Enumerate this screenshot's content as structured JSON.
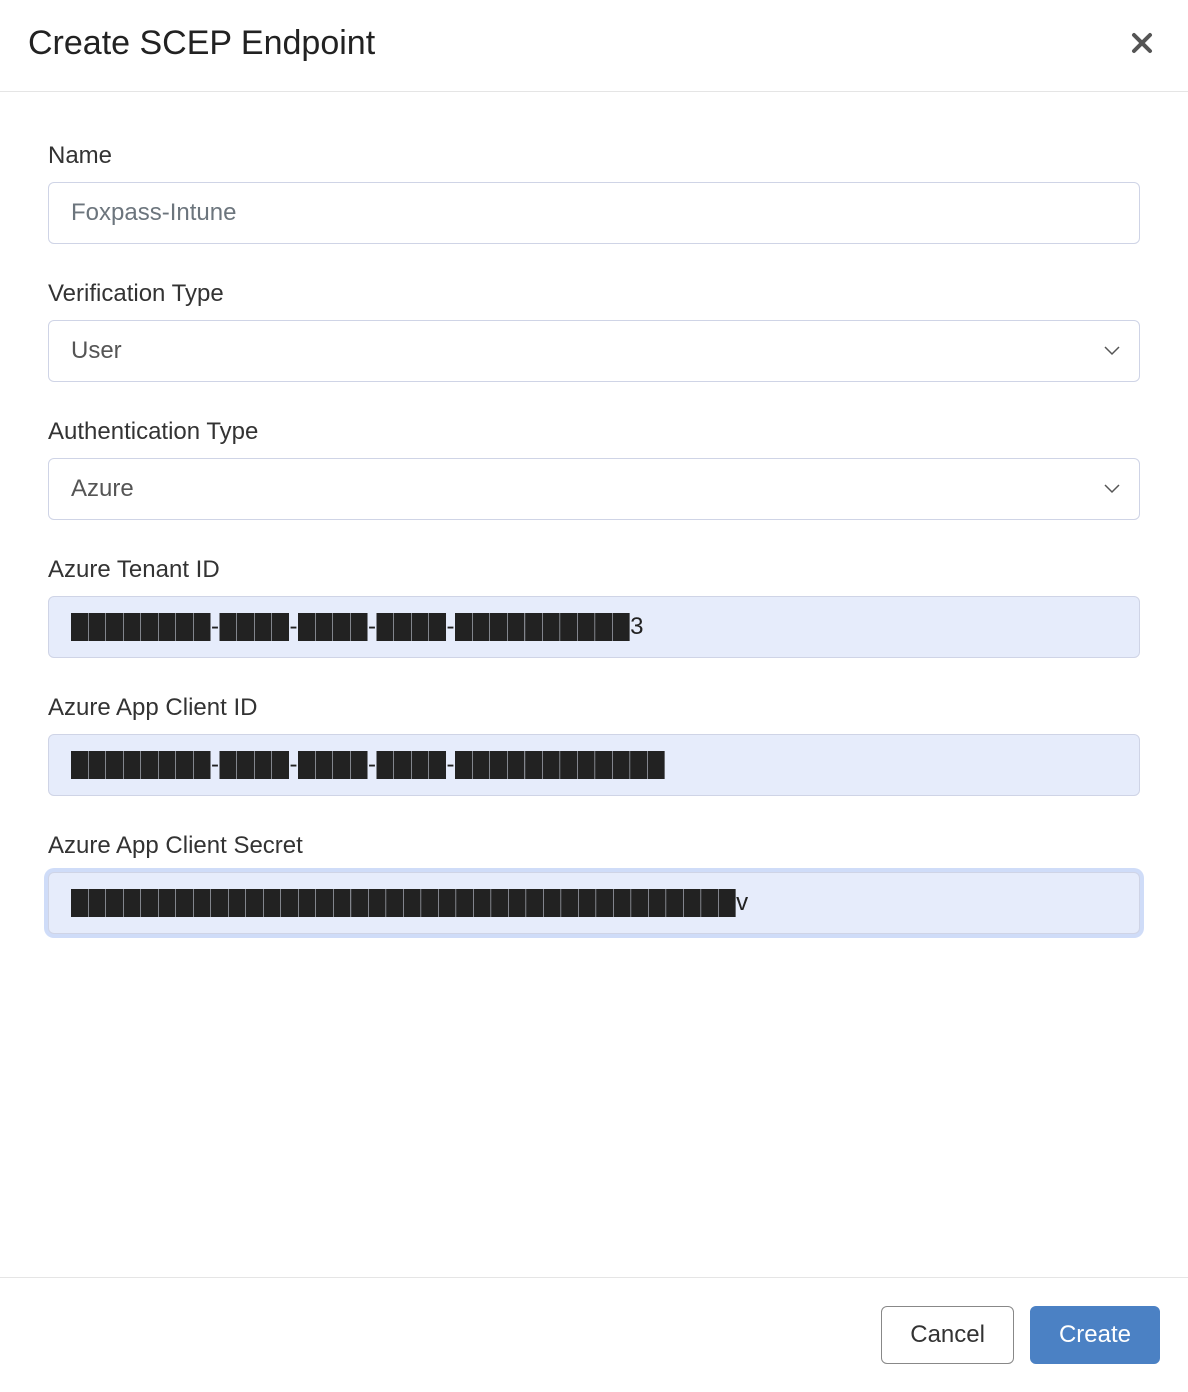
{
  "dialog": {
    "title": "Create SCEP Endpoint"
  },
  "form": {
    "name": {
      "label": "Name",
      "placeholder": "Foxpass-Intune",
      "value": ""
    },
    "verification_type": {
      "label": "Verification Type",
      "selected": "User"
    },
    "authentication_type": {
      "label": "Authentication Type",
      "selected": "Azure"
    },
    "azure_tenant_id": {
      "label": "Azure Tenant ID",
      "value_redacted": "████████-████-████-████-██████████3"
    },
    "azure_app_client_id": {
      "label": "Azure App Client ID",
      "value_redacted": "████████-████-████-████-████████████"
    },
    "azure_app_client_secret": {
      "label": "Azure App Client Secret",
      "value_redacted": "██████████████████████████████████████v"
    }
  },
  "footer": {
    "cancel_label": "Cancel",
    "create_label": "Create"
  },
  "icons": {
    "close": "close-icon",
    "chevron_down": "chevron-down-icon"
  },
  "colors": {
    "primary": "#4b81c4",
    "input_border": "#cfd4e6",
    "filled_bg": "#e6ecfb",
    "focus_ring": "#cfdcf8",
    "divider": "#e5e5e5"
  }
}
